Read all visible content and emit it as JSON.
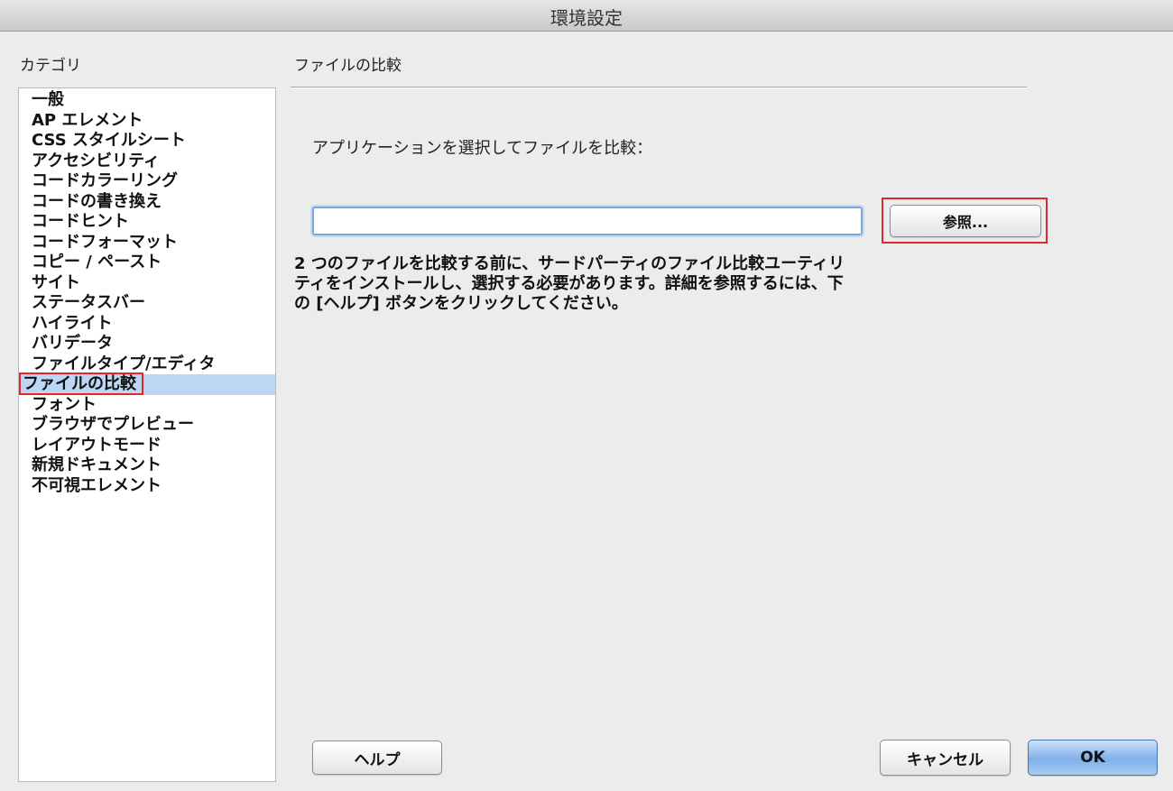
{
  "window": {
    "title": "環境設定"
  },
  "categories": {
    "heading": "カテゴリ",
    "items": [
      "一般",
      "AP エレメント",
      "CSS スタイルシート",
      "アクセシビリティ",
      "コードカラーリング",
      "コードの書き換え",
      "コードヒント",
      "コードフォーマット",
      "コピー / ペースト",
      "サイト",
      "ステータスバー",
      "ハイライト",
      "バリデータ",
      "ファイルタイプ/エディタ",
      "ファイルの比較",
      "フォント",
      "ブラウザでプレビュー",
      "レイアウトモード",
      "新規ドキュメント",
      "不可視エレメント"
    ],
    "selected_index": 14
  },
  "panel": {
    "heading": "ファイルの比較",
    "prompt_label": "アプリケーションを選択してファイルを比較：",
    "path_value": "",
    "browse_label": "参照...",
    "help_lines": [
      "2 つのファイルを比較する前に、サードパーティのファイル比較ユーティリ",
      "ティをインストールし、選択する必要があります。詳細を参照するには、下",
      "の [ヘルプ] ボタンをクリックしてください。"
    ]
  },
  "footer": {
    "help_label": "ヘルプ",
    "cancel_label": "キャンセル",
    "ok_label": "OK"
  },
  "colors": {
    "selection_bg": "#bcd6f3",
    "highlight_border": "#e3262c",
    "default_button": "#7fb0ea"
  }
}
